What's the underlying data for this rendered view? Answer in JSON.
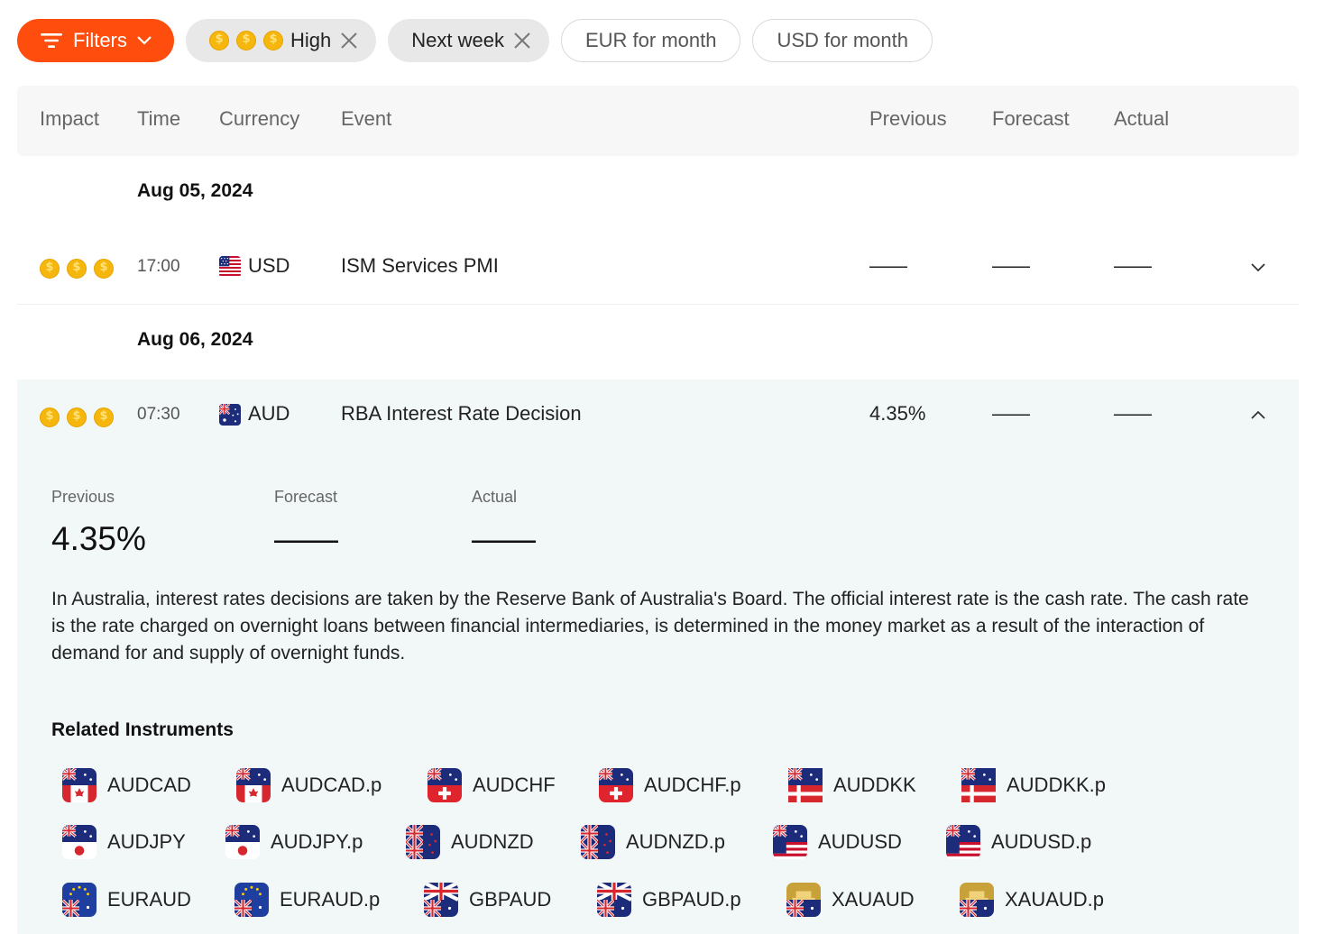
{
  "filters": {
    "filters_label": "Filters",
    "impact_label": "High",
    "period_label": "Next week",
    "suggestions": [
      "EUR for month",
      "USD for month"
    ]
  },
  "table": {
    "headers": [
      "Impact",
      "Time",
      "Currency",
      "Event",
      "Previous",
      "Forecast",
      "Actual"
    ]
  },
  "groups": [
    {
      "date": "Aug 05, 2024",
      "events": [
        {
          "impact": 3,
          "time": "17:00",
          "currency": "USD",
          "event": "ISM Services PMI",
          "previous": "——",
          "forecast": "——",
          "actual": "——",
          "expanded": false
        }
      ]
    },
    {
      "date": "Aug 06, 2024",
      "events": [
        {
          "impact": 3,
          "time": "07:30",
          "currency": "AUD",
          "event": "RBA Interest Rate Decision",
          "previous": "4.35%",
          "forecast": "——",
          "actual": "——",
          "expanded": true
        }
      ]
    }
  ],
  "details": {
    "previous_label": "Previous",
    "forecast_label": "Forecast",
    "actual_label": "Actual",
    "previous_value": "4.35%",
    "forecast_value": "——",
    "actual_value": "——",
    "description": "In Australia, interest rates decisions are taken by the Reserve Bank of Australia's Board. The official interest rate is the cash rate. The cash rate is the rate charged on overnight loans between financial intermediaries, is determined in the money market as a result of the interaction of demand for and supply of overnight funds.",
    "related_title": "Related Instruments",
    "instruments": [
      [
        "AUDCAD",
        "AUDCAD.p",
        "AUDCHF",
        "AUDCHF.p",
        "AUDDKK",
        "AUDDKK.p"
      ],
      [
        "AUDJPY",
        "AUDJPY.p",
        "AUDNZD",
        "AUDNZD.p",
        "AUDUSD",
        "AUDUSD.p"
      ],
      [
        "EURAUD",
        "EURAUD.p",
        "GBPAUD",
        "GBPAUD.p",
        "XAUAUD",
        "XAUAUD.p"
      ]
    ]
  },
  "colors": {
    "accent": "#ff4d0d",
    "coin": "#f5b60d",
    "expanded_bg": "#f2f8f8"
  }
}
